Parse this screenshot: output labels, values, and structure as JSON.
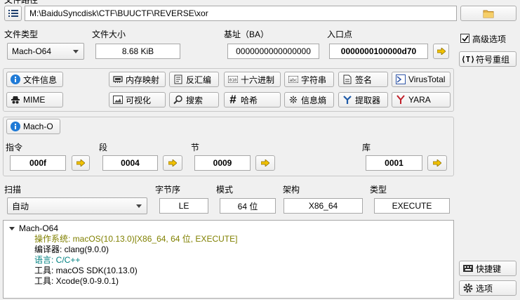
{
  "window": {
    "title_fragment": "文件路径"
  },
  "toolbar": {
    "path": "M:\\BaiduSyncdisk\\CTF\\BUUCTF\\REVERSE\\xor",
    "menu_icon": "list-icon",
    "open_icon": "folder-icon"
  },
  "info": {
    "file_type_label": "文件类型",
    "file_type_value": "Mach-O64",
    "file_size_label": "文件大小",
    "file_size_value": "8.68 KiB",
    "base_label": "基址（BA）",
    "base_value": "0000000000000000",
    "entry_label": "入口点",
    "entry_value": "0000000100000d70"
  },
  "side": {
    "advanced_label": "高级选项",
    "advanced_checked": true,
    "symbol_label": "符号重组",
    "shortcut_label": "快捷键",
    "options_label": "选项"
  },
  "tools": {
    "row1": [
      "文件信息",
      "内存映射",
      "反汇编",
      "十六进制",
      "字符串",
      "签名",
      "VirusTotal"
    ],
    "row2": [
      "MIME",
      "可视化",
      "搜索",
      "哈希",
      "信息熵",
      "提取器",
      "YARA"
    ]
  },
  "macho": {
    "button_label": "Mach-O",
    "commands_label": "指令",
    "commands_value": "000f",
    "segments_label": "段",
    "segments_value": "0004",
    "sections_label": "节",
    "sections_value": "0009",
    "libs_label": "库",
    "libs_value": "0001"
  },
  "scan": {
    "scan_label": "扫描",
    "scan_value": "自动",
    "endian_label": "字节序",
    "endian_value": "LE",
    "mode_label": "模式",
    "mode_value": "64 位",
    "arch_label": "架构",
    "arch_value": "X86_64",
    "type_label": "类型",
    "type_value": "EXECUTE"
  },
  "results": {
    "root": "Mach-O64",
    "items": [
      {
        "text": "操作系统: macOS(10.13.0)[X86_64, 64 位, EXECUTE]",
        "color": "#808000"
      },
      {
        "text": "编译器: clang(9.0.0)",
        "color": "#000000"
      },
      {
        "text": "语言: C/C++",
        "color": "#008080"
      },
      {
        "text": "工具: macOS SDK(10.13.0)",
        "color": "#000000"
      },
      {
        "text": "工具: Xcode(9.0-9.0.1)",
        "color": "#000000"
      }
    ]
  }
}
